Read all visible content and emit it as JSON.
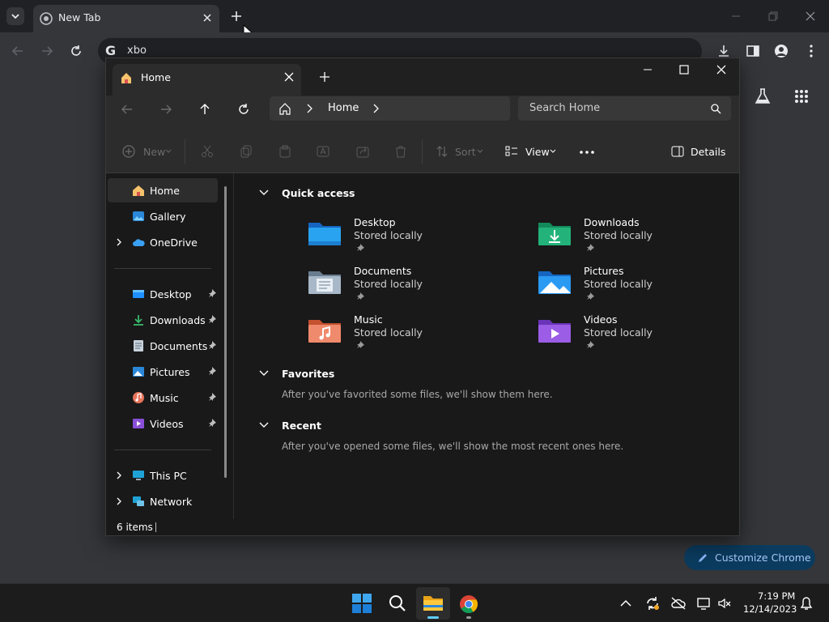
{
  "chrome": {
    "tab_title": "New Tab",
    "omnibox_text": "xbo",
    "customize_label": "Customize Chrome"
  },
  "explorer": {
    "tab_title": "Home",
    "address": {
      "crumb": "Home"
    },
    "search_placeholder": "Search Home",
    "cmd": {
      "new": "New",
      "sort": "Sort",
      "view": "View",
      "details": "Details"
    },
    "nav": {
      "home": "Home",
      "gallery": "Gallery",
      "onedrive": "OneDrive",
      "desktop": "Desktop",
      "downloads": "Downloads",
      "documents": "Documents",
      "pictures": "Pictures",
      "music": "Music",
      "videos": "Videos",
      "thispc": "This PC",
      "network": "Network"
    },
    "sections": {
      "quick_access": "Quick access",
      "favorites": "Favorites",
      "favorites_empty": "After you've favorited some files, we'll show them here.",
      "recent": "Recent",
      "recent_empty": "After you've opened some files, we'll show the most recent ones here."
    },
    "quick_items": [
      {
        "name": "Desktop",
        "sub": "Stored locally"
      },
      {
        "name": "Downloads",
        "sub": "Stored locally"
      },
      {
        "name": "Documents",
        "sub": "Stored locally"
      },
      {
        "name": "Pictures",
        "sub": "Stored locally"
      },
      {
        "name": "Music",
        "sub": "Stored locally"
      },
      {
        "name": "Videos",
        "sub": "Stored locally"
      }
    ],
    "status": "6 items"
  },
  "taskbar": {
    "time": "7:19 PM",
    "date": "12/14/2023"
  }
}
